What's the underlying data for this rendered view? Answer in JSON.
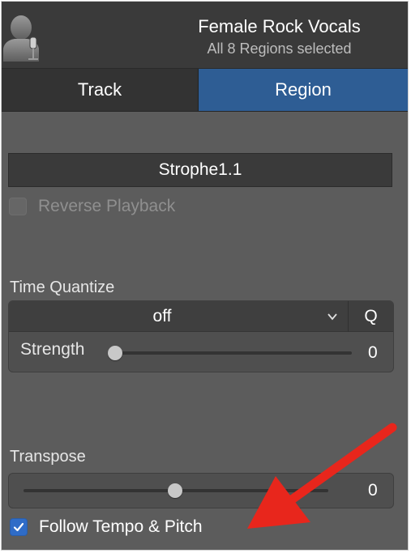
{
  "header": {
    "title": "Female Rock Vocals",
    "subtitle": "All 8 Regions selected",
    "avatar_icon": "singer-microphone-icon"
  },
  "tabs": [
    {
      "label": "Track",
      "active": false
    },
    {
      "label": "Region",
      "active": true
    }
  ],
  "region": {
    "name": "Strophe1.1",
    "reverse_playback": {
      "label": "Reverse Playback",
      "checked": false,
      "enabled": false
    }
  },
  "time_quantize": {
    "label": "Time Quantize",
    "value": "off",
    "q_button": "Q",
    "strength": {
      "label": "Strength",
      "value": "0"
    }
  },
  "transpose": {
    "label": "Transpose",
    "value": "0"
  },
  "follow_tempo": {
    "label": "Follow Tempo & Pitch",
    "checked": true
  },
  "colors": {
    "accent": "#2e5d94",
    "checkbox": "#2f6cc7",
    "annotation_arrow": "#e8261c"
  }
}
